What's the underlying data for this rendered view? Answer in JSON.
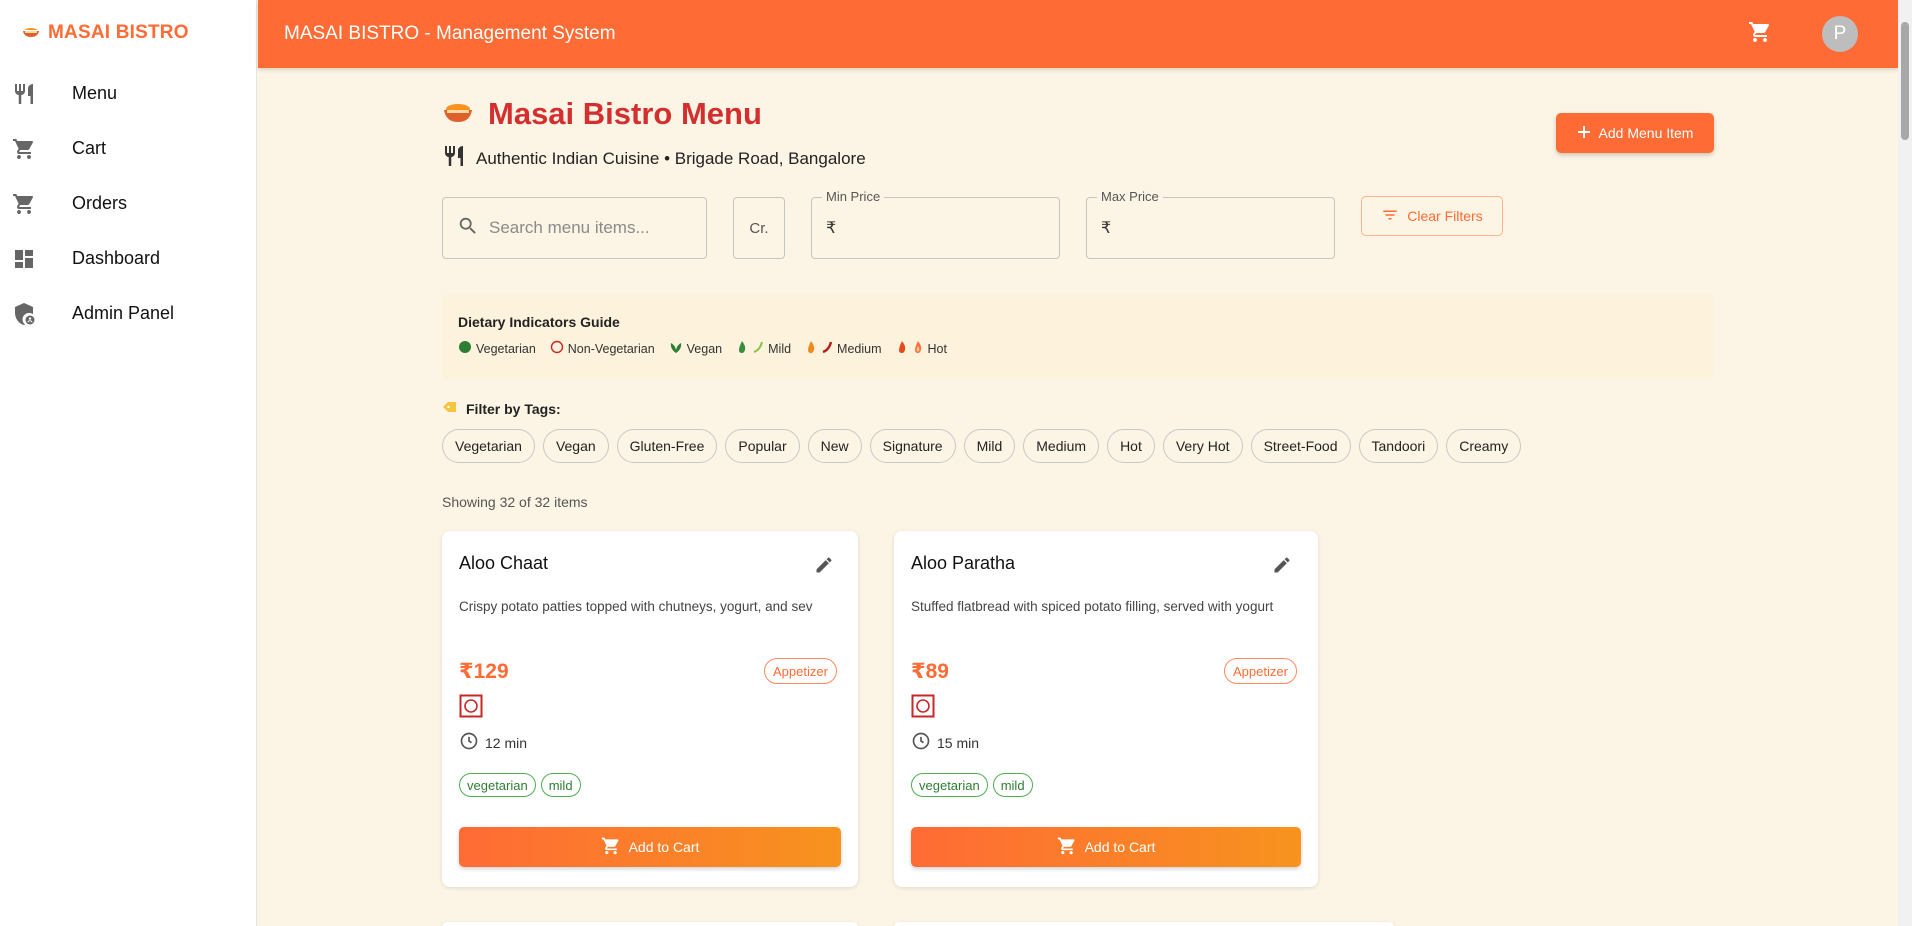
{
  "brand": {
    "name": "MASAI BISTRO",
    "icon": "food-bowl-icon"
  },
  "sidebar": {
    "items": [
      {
        "label": "Menu",
        "icon": "utensils-icon"
      },
      {
        "label": "Cart",
        "icon": "cart-icon"
      },
      {
        "label": "Orders",
        "icon": "cart-icon"
      },
      {
        "label": "Dashboard",
        "icon": "dashboard-icon"
      },
      {
        "label": "Admin Panel",
        "icon": "admin-shield-icon"
      }
    ]
  },
  "header": {
    "title": "MASAI BISTRO - Management System",
    "avatar_initial": "P"
  },
  "main": {
    "title": "Masai Bistro Menu",
    "subtitle": "Authentic Indian Cuisine • Brigade Road, Bangalore",
    "add_button": "Add Menu Item",
    "search": {
      "placeholder": "Search menu items...",
      "value": ""
    },
    "sort_value": "Cr.",
    "min_price": {
      "label": "Min Price",
      "currency": "₹",
      "value": ""
    },
    "max_price": {
      "label": "Max Price",
      "currency": "₹",
      "value": ""
    },
    "clear_filters": "Clear Filters",
    "dietary_guide": {
      "title": "Dietary Indicators Guide",
      "items": [
        "Vegetarian",
        "Non-Vegetarian",
        "Vegan",
        "Mild",
        "Medium",
        "Hot"
      ]
    },
    "tags_label": "Filter by Tags:",
    "tags": [
      "Vegetarian",
      "Vegan",
      "Gluten-Free",
      "Popular",
      "New",
      "Signature",
      "Mild",
      "Medium",
      "Hot",
      "Very Hot",
      "Street-Food",
      "Tandoori",
      "Creamy"
    ],
    "showing": "Showing 32 of 32 items",
    "items": [
      {
        "name": "Aloo Chaat",
        "description": "Crispy potato patties topped with chutneys, yogurt, and sev",
        "price": "₹129",
        "category": "Appetizer",
        "time": "12 min",
        "tags": [
          "vegetarian",
          "mild"
        ],
        "cta": "Add to Cart"
      },
      {
        "name": "Aloo Paratha",
        "description": "Stuffed flatbread with spiced potato filling, served with yogurt",
        "price": "₹89",
        "category": "Appetizer",
        "time": "15 min",
        "tags": [
          "vegetarian",
          "mild"
        ],
        "cta": "Add to Cart"
      }
    ]
  },
  "colors": {
    "primary": "#ff6b35",
    "title": "#d32f2f",
    "background": "#fcf5e5",
    "veg_green": "#2e7d32"
  }
}
